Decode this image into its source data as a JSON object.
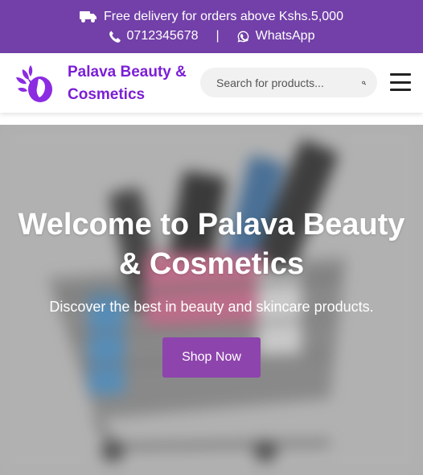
{
  "top_bar": {
    "delivery_text": "Free delivery for orders above Kshs.5,000",
    "phone": "0712345678",
    "separator": "|",
    "whatsapp_label": "WhatsApp"
  },
  "header": {
    "brand_name": "Palava Beauty & Cosmetics",
    "search_placeholder": "Search for products...",
    "logo_icon": "woman-face-flower-logo",
    "menu_icon": "hamburger-menu-icon"
  },
  "hero": {
    "title": "Welcome to Palava Beauty & Cosmetics",
    "subtitle": "Discover the best in beauty and skincare products.",
    "cta_label": "Shop Now",
    "background_image": "blurred shopping cart with cosmetics"
  },
  "colors": {
    "top_bar_bg": "#7240a8",
    "brand_text": "#7b1fd6",
    "cta_bg": "#8e44ad"
  }
}
